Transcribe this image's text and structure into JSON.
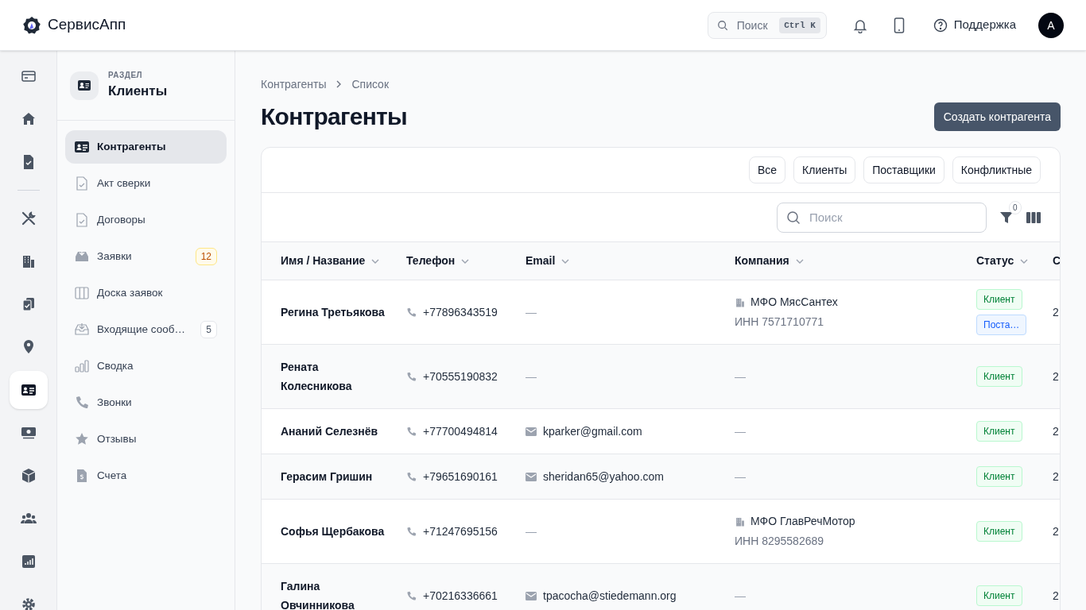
{
  "app": {
    "name": "СервисАпп"
  },
  "topbar": {
    "search_placeholder": "Поиск",
    "shortcut": "Ctrl K",
    "support": "Поддержка",
    "avatar": "А"
  },
  "rail": [
    {
      "selected": false
    },
    {
      "selected": false
    },
    {
      "selected": false
    },
    {
      "selected": false
    },
    {
      "selected": false
    },
    {
      "selected": false
    },
    {
      "selected": false
    },
    {
      "selected": true
    },
    {
      "selected": false
    },
    {
      "selected": false
    },
    {
      "selected": false
    },
    {
      "selected": false
    },
    {
      "selected": false
    }
  ],
  "section": {
    "caption": "РАЗДЕЛ",
    "title": "Клиенты"
  },
  "menu": [
    {
      "label": "Контрагенты",
      "selected": true
    },
    {
      "label": "Акт сверки",
      "selected": false
    },
    {
      "label": "Договоры",
      "selected": false
    },
    {
      "label": "Заявки",
      "selected": false,
      "badge": "12",
      "kind": "warning"
    },
    {
      "label": "Доска заявок",
      "selected": false
    },
    {
      "label": "Входящие сооб…",
      "selected": false,
      "badge": "5",
      "kind": "neutral"
    },
    {
      "label": "Сводка",
      "selected": false
    },
    {
      "label": "Звонки",
      "selected": false
    },
    {
      "label": "Отзывы",
      "selected": false
    },
    {
      "label": "Счета",
      "selected": false
    }
  ],
  "breadcrumbs": [
    "Контрагенты",
    "Список"
  ],
  "title": "Контрагенты",
  "create_button": "Создать контрагента",
  "filters": [
    {
      "label": "Все"
    },
    {
      "label": "Клиенты"
    },
    {
      "label": "Поставщики"
    },
    {
      "label": "Конфликтные"
    }
  ],
  "table_search_placeholder": "Поиск",
  "filter_count": "0",
  "table": {
    "columns": [
      "Имя / Название",
      "Телефон",
      "Email",
      "Компания",
      "Статус",
      "С"
    ],
    "rows": [
      {
        "name": "Регина Третьякова",
        "phone": "+77896343519",
        "email": "—",
        "company": "МФО МясСантех",
        "inn": "ИНН 7571710771",
        "statuses": [
          {
            "label": "Клиент",
            "kind": "client"
          },
          {
            "label": "Поста…",
            "kind": "supplier"
          }
        ],
        "column_6": "2"
      },
      {
        "name": "Рената Колесникова",
        "phone": "+70555190832",
        "email": "—",
        "company": "—",
        "statuses": [
          {
            "label": "Клиент",
            "kind": "client"
          }
        ],
        "column_6": "2"
      },
      {
        "name": "Ананий Селезнёв",
        "phone": "+77700494814",
        "email": "kparker@gmail.com",
        "company": "—",
        "statuses": [
          {
            "label": "Клиент",
            "kind": "client"
          }
        ],
        "column_6": "2"
      },
      {
        "name": "Герасим Гришин",
        "phone": "+79651690161",
        "email": "sheridan65@yahoo.com",
        "company": "—",
        "statuses": [
          {
            "label": "Клиент",
            "kind": "client"
          }
        ],
        "column_6": "2"
      },
      {
        "name": "Софья Щербакова",
        "phone": "+71247695156",
        "email": "—",
        "company": "МФО ГлавРечМотор",
        "inn": "ИНН 8295582689",
        "statuses": [
          {
            "label": "Клиент",
            "kind": "client"
          }
        ],
        "column_6": "2"
      },
      {
        "name": "Галина Овчинникова",
        "phone": "+70216336661",
        "email": "tpacocha@stiedemann.org",
        "company": "—",
        "statuses": [
          {
            "label": "Клиент",
            "kind": "client"
          }
        ],
        "column_6": "2"
      }
    ]
  }
}
